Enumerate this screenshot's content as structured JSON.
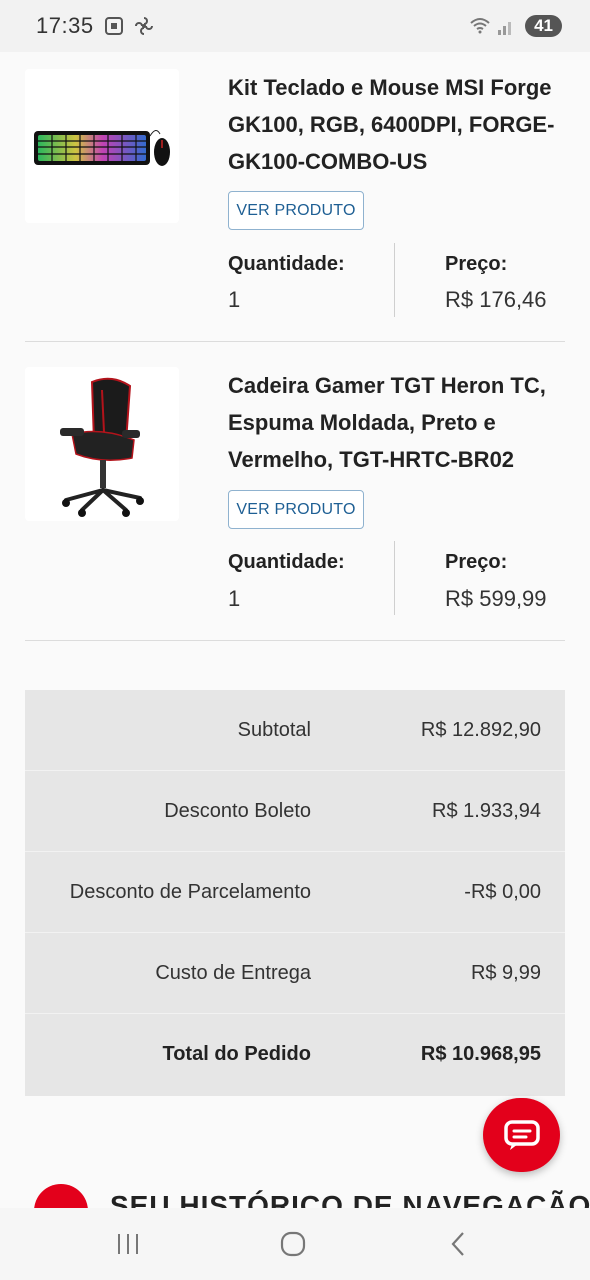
{
  "status_bar": {
    "time": "17:35",
    "battery": "41"
  },
  "products": [
    {
      "title": "Kit Teclado e Mouse MSI Forge GK100, RGB, 6400DPI, FORGE-GK100-COMBO-US",
      "button_label": "VER PRODUTO",
      "quantity_label": "Quantidade:",
      "quantity": "1",
      "price_label": "Preço:",
      "price": "R$ 176,46"
    },
    {
      "title": "Cadeira Gamer TGT Heron TC, Espuma Moldada, Preto e Vermelho, TGT-HRTC-BR02",
      "button_label": "VER PRODUTO",
      "quantity_label": "Quantidade:",
      "quantity": "1",
      "price_label": "Preço:",
      "price": "R$ 599,99"
    }
  ],
  "summary": {
    "rows": [
      {
        "label": "Subtotal",
        "value": "R$ 12.892,90"
      },
      {
        "label": "Desconto Boleto",
        "value": "R$ 1.933,94"
      },
      {
        "label": "Desconto de Parcelamento",
        "value": "-R$ 0,00"
      },
      {
        "label": "Custo de Entrega",
        "value": "R$ 9,99"
      },
      {
        "label": "Total do Pedido",
        "value": "R$ 10.968,95"
      }
    ]
  },
  "history": {
    "title": "SEU HISTÓRICO DE NAVEGAÇÃO"
  },
  "colors": {
    "accent": "#e3001b",
    "button_text": "#1e5f94",
    "summary_bg": "#e6e6e6"
  },
  "icons": {
    "chat": "chat-bubble-icon",
    "history": "history-icon",
    "nav_recent": "recent-apps-icon",
    "nav_home": "home-icon",
    "nav_back": "back-icon"
  }
}
